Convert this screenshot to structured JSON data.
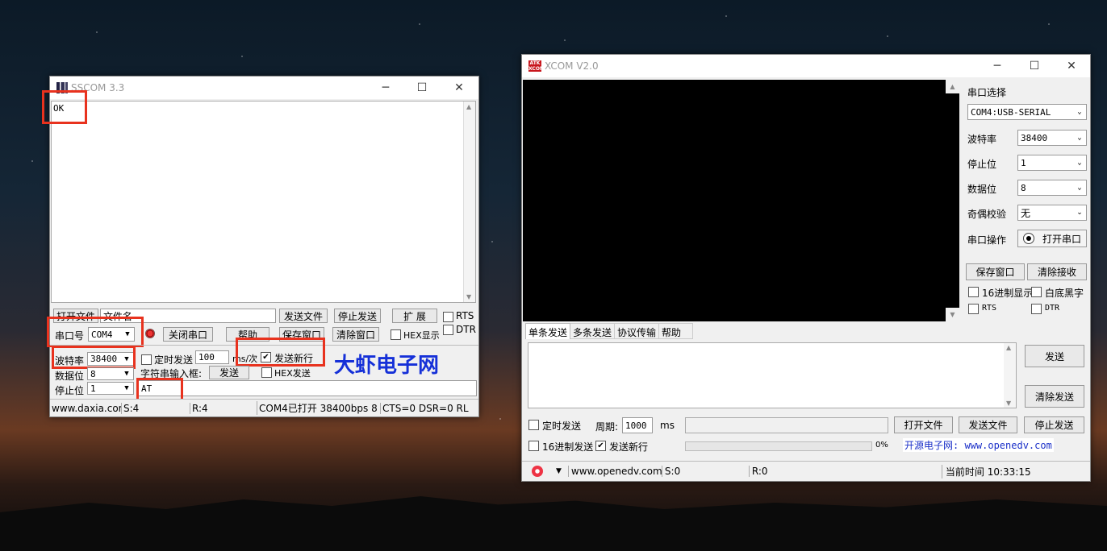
{
  "sscom": {
    "title": "SSCOM 3.3",
    "receive_text": "OK",
    "btn_open_file": "打开文件",
    "filename_placeholder": "文件名",
    "btn_send_file": "发送文件",
    "btn_stop_send": "停止发送",
    "btn_expand": "扩 展",
    "rts_label": "RTS",
    "dtr_label": "DTR",
    "port_label": "串口号",
    "port_value": "COM4",
    "btn_close_port": "关闭串口",
    "btn_help": "帮助",
    "btn_save_window": "保存窗口",
    "btn_clear_window": "清除窗口",
    "hex_display": "HEX显示",
    "baud_label": "波特率",
    "baud_value": "38400",
    "timed_send": "定时发送",
    "period_value": "100",
    "period_unit": "ms/次",
    "send_newline": "发送新行",
    "databits_label": "数据位",
    "databits_value": "8",
    "input_label": "字符串输入框:",
    "btn_send": "发送",
    "hex_send": "HEX发送",
    "stopbits_label": "停止位",
    "stopbits_value": "1",
    "send_text": "AT",
    "brand": "大虾电子网",
    "status": {
      "site": "www.daxia.cor",
      "s": "S:4",
      "r": "R:4",
      "state": "COM4已打开  38400bps  8",
      "lines": "CTS=0 DSR=0 RL"
    }
  },
  "xcom": {
    "title": "XCOM V2.0",
    "port_select_label": "串口选择",
    "port_value": "COM4:USB-SERIAL",
    "baud_label": "波特率",
    "baud_value": "38400",
    "stopbits_label": "停止位",
    "stopbits_value": "1",
    "databits_label": "数据位",
    "databits_value": "8",
    "parity_label": "奇偶校验",
    "parity_value": "无",
    "port_op_label": "串口操作",
    "btn_open_port": "打开串口",
    "btn_save_window": "保存窗口",
    "btn_clear_receive": "清除接收",
    "hex_display": "16进制显示",
    "white_bg": "白底黑字",
    "rts": "RTS",
    "dtr": "DTR",
    "tabs": [
      "单条发送",
      "多条发送",
      "协议传输",
      "帮助"
    ],
    "btn_send": "发送",
    "btn_clear_send": "清除发送",
    "timed_send": "定时发送",
    "period_label": "周期:",
    "period_value": "1000",
    "period_unit": "ms",
    "btn_open_file": "打开文件",
    "btn_send_file": "发送文件",
    "btn_stop_send": "停止发送",
    "hex_send": "16进制发送",
    "send_newline": "发送新行",
    "progress": "0%",
    "promo": "开源电子网: www.openedv.com",
    "status": {
      "site": "www.openedv.com",
      "s": "S:0",
      "r": "R:0",
      "time": "当前时间 10:33:15"
    }
  }
}
